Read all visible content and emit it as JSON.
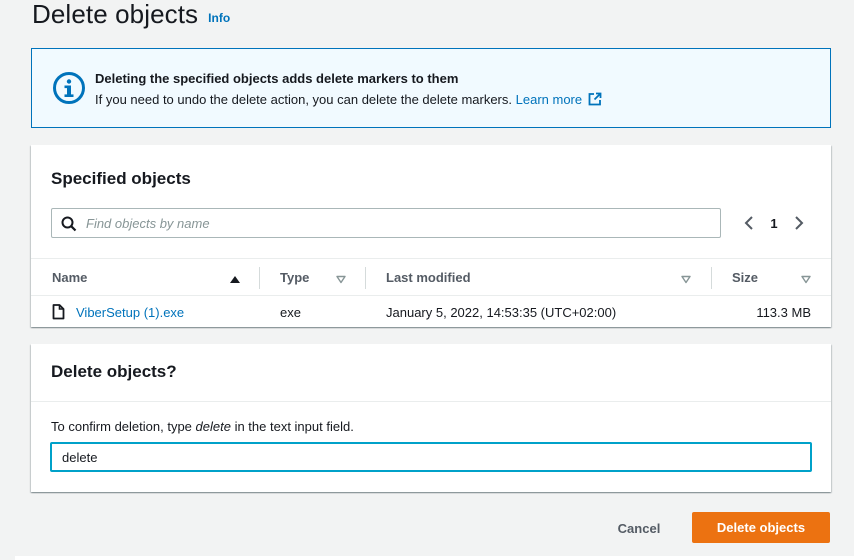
{
  "header": {
    "title": "Delete objects",
    "info_link": "Info"
  },
  "alert": {
    "icon": "info-circle-icon",
    "title": "Deleting the specified objects adds delete markers to them",
    "text": "If you need to undo the delete action, you can delete the delete markers.",
    "link_label": "Learn more",
    "link_icon": "external-link-icon"
  },
  "objects_panel": {
    "title": "Specified objects",
    "search": {
      "placeholder": "Find objects by name",
      "value": ""
    },
    "pagination": {
      "current_page": "1"
    },
    "columns": [
      {
        "label": "Name",
        "sort": "ascending"
      },
      {
        "label": "Type",
        "sort": "none"
      },
      {
        "label": "Last modified",
        "sort": "none"
      },
      {
        "label": "Size",
        "sort": "none"
      }
    ],
    "rows": [
      {
        "name": "ViberSetup (1).exe",
        "type": "exe",
        "last_modified": "January 5, 2022, 14:53:35 (UTC+02:00)",
        "size": "113.3 MB"
      }
    ]
  },
  "confirm_panel": {
    "title": "Delete objects?",
    "label_before": "To confirm deletion, type ",
    "label_keyword": "delete",
    "label_after": " in the text input field.",
    "input_value": "delete"
  },
  "actions": {
    "cancel_label": "Cancel",
    "delete_label": "Delete objects"
  },
  "colors": {
    "primary_button": "#ec7211",
    "link": "#0073bb",
    "info_border": "#0073bb",
    "info_background": "#f1faff",
    "focus_border": "#00a1c9",
    "page_background": "#f2f3f3"
  }
}
